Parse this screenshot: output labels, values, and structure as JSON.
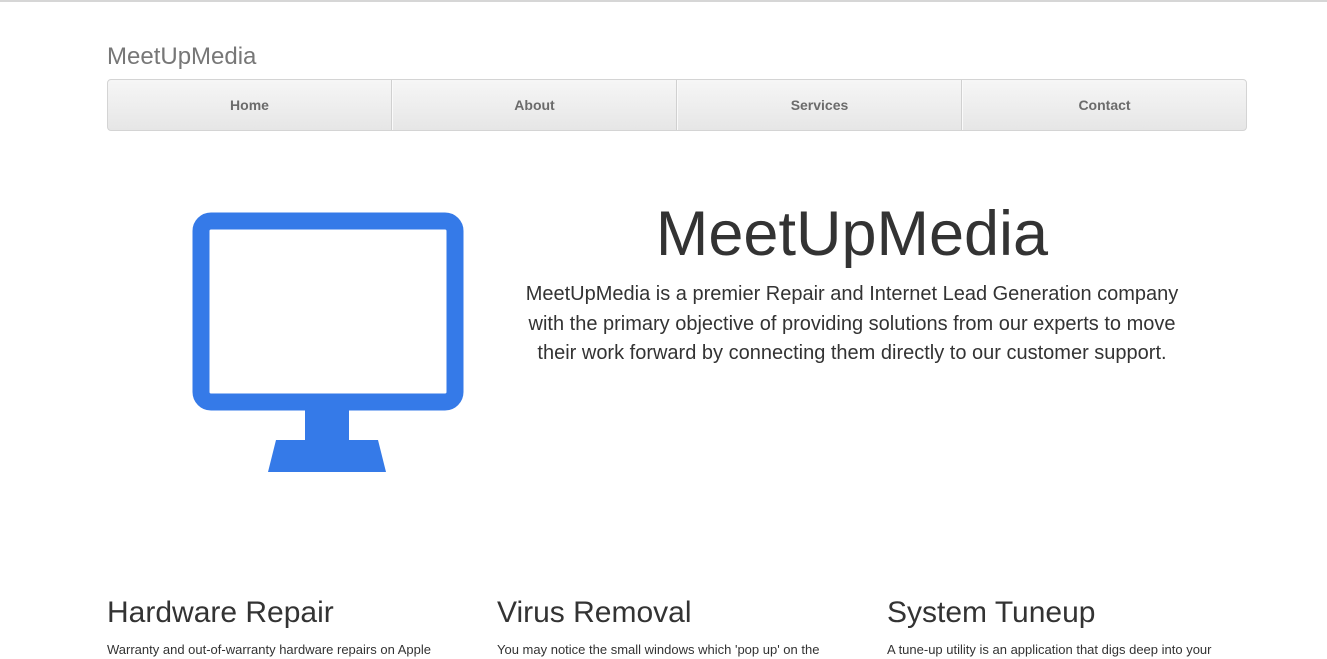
{
  "brand": "MeetUpMedia",
  "nav": {
    "items": [
      {
        "label": "Home"
      },
      {
        "label": "About"
      },
      {
        "label": "Services"
      },
      {
        "label": "Contact"
      }
    ]
  },
  "hero": {
    "icon": "monitor-icon",
    "icon_color": "#357AE8",
    "title": "MeetUpMedia",
    "text": "MeetUpMedia is a premier Repair and Internet Lead Generation company with the primary objective of providing solutions from our experts to move their work forward by connecting them directly to our customer support."
  },
  "features": [
    {
      "title": "Hardware Repair",
      "text": "Warranty and out-of-warranty hardware repairs on Apple"
    },
    {
      "title": "Virus Removal",
      "text": "You may notice the small windows which 'pop up' on the"
    },
    {
      "title": "System Tuneup",
      "text": "A tune-up utility is an application that digs deep into your"
    }
  ]
}
